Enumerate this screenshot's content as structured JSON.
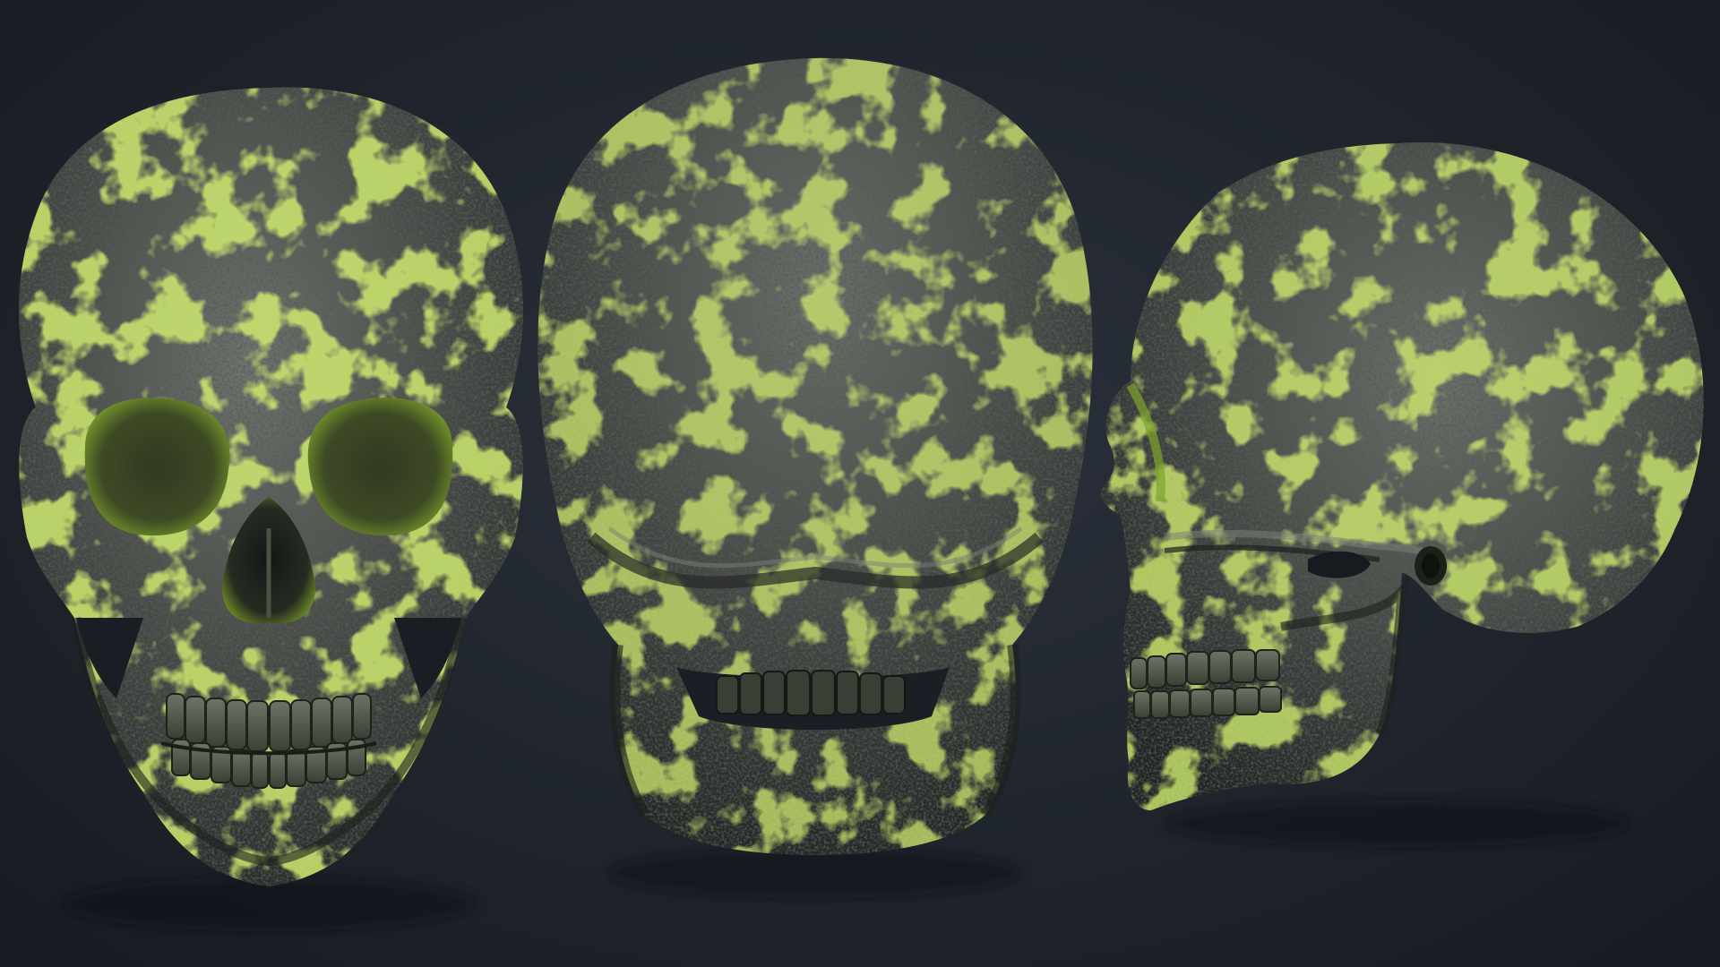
{
  "scene": {
    "background": [
      "#2b313b",
      "#20252d",
      "#171b21"
    ],
    "bone_color": "#4a4f4a",
    "bone_dark": "#2a2e2b",
    "bone_light": "#7b807a",
    "moss_color": "#9fcf2a",
    "moss_dark": "#5f7f16",
    "views": [
      {
        "name": "skull-front-view",
        "orientation": "front"
      },
      {
        "name": "skull-back-view",
        "orientation": "back"
      },
      {
        "name": "skull-side-view",
        "orientation": "side"
      }
    ]
  }
}
